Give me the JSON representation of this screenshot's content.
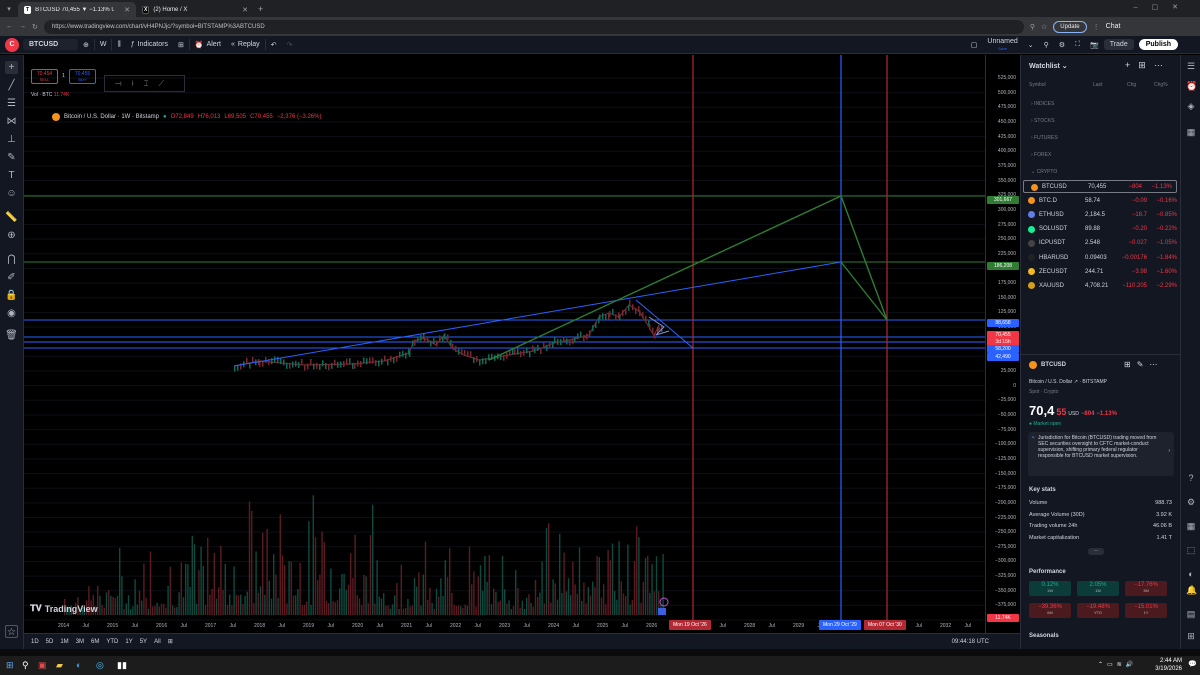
{
  "browser": {
    "tabs": [
      {
        "label": "BTCUSD 70,455 ▼ −1.13% Unna…",
        "fav": "TV"
      },
      {
        "label": "(2) Home / X",
        "fav": "X"
      }
    ],
    "url": "https://www.tradingview.com/chart/vH4PNJjc/?symbol=BITSTAMP%3ABTCUSD",
    "update_label": "Update",
    "chat_label": "Chat"
  },
  "toolbar": {
    "symbol": "BTCUSD",
    "interval": "W",
    "indicators_label": "Indicators",
    "alert_label": "Alert",
    "replay_label": "Replay",
    "layout_name": "Unnamed",
    "layout_sub": "Save",
    "trade_label": "Trade",
    "publish_label": "Publish"
  },
  "legend": {
    "title": "Bitcoin / U.S. Dollar · 1W · Bitstamp",
    "o": "O72,849",
    "h": "H76,013",
    "l": "L69,505",
    "c": "C70,455",
    "chg": "−2,376 (−3.26%)",
    "sell_price": "70,454",
    "sell_label": "SELL",
    "spread": "1",
    "buy_price": "70,455",
    "buy_label": "BUY",
    "vol_label": "Vol · BTC",
    "vol_value": "11.74K"
  },
  "price_axis": {
    "labels": [
      "525,000",
      "500,000",
      "475,000",
      "450,000",
      "425,000",
      "400,000",
      "375,000",
      "350,000",
      "325,000",
      "300,000",
      "275,000",
      "250,000",
      "225,000",
      "200,000",
      "175,000",
      "150,000",
      "125,000",
      "100,000",
      "75,000",
      "50,000",
      "25,000",
      "0",
      "−25,000",
      "−50,000",
      "−75,000",
      "−100,000",
      "−125,000",
      "−150,000",
      "−175,000",
      "−200,000",
      "−225,000",
      "−250,000",
      "−275,000",
      "−300,000",
      "−325,000",
      "−350,000",
      "−375,000",
      "−400,000"
    ],
    "tags": [
      {
        "text": "301,667",
        "color": "#2e7d32"
      },
      {
        "text": "186,208",
        "color": "#2e7d32"
      },
      {
        "text": "88,658",
        "color": "#2962ff"
      },
      {
        "text": "70,455",
        "color": "#f23645"
      },
      {
        "text": "3d 15h",
        "color": "#f23645"
      },
      {
        "text": "58,200",
        "color": "#2962ff"
      },
      {
        "text": "42,490",
        "color": "#2962ff"
      },
      {
        "text": "11.74K",
        "color": "#f23645"
      }
    ]
  },
  "time_axis": {
    "labels": [
      "2014",
      "Jul",
      "2015",
      "Jul",
      "2016",
      "Jul",
      "2017",
      "Jul",
      "2018",
      "Jul",
      "2019",
      "Jul",
      "2020",
      "Jul",
      "2021",
      "Jul",
      "2022",
      "Jul",
      "2023",
      "Jul",
      "2024",
      "Jul",
      "2025",
      "Jul",
      "2026",
      "Jul",
      "2027",
      "Jul",
      "2028",
      "Jul",
      "2029",
      "Jul",
      "2030",
      "Jul",
      "2031",
      "Jul",
      "2032",
      "Jul"
    ],
    "date_tags": [
      {
        "text": "Mon 19 Oct '26",
        "color": "#b22833"
      },
      {
        "text": "Mon 29 Oct '29",
        "color": "#2962ff"
      },
      {
        "text": "Mon 07 Oct '30",
        "color": "#b22833"
      }
    ],
    "clock": "09:44:18 UTC"
  },
  "ranges": [
    "1D",
    "5D",
    "1M",
    "3M",
    "6M",
    "YTD",
    "1Y",
    "5Y",
    "All"
  ],
  "watermark": "TradingView",
  "watchlist": {
    "title": "Watchlist",
    "cols": [
      "Symbol",
      "Last",
      "Chg",
      "Chg%"
    ],
    "groups": [
      "INDICES",
      "STOCKS",
      "FUTURES",
      "FOREX",
      "CRYPTO"
    ],
    "rows": [
      {
        "sym": "BTCUSD",
        "last": "70,455",
        "chg": "−804",
        "pct": "−1.13%",
        "coin": "#f7931a",
        "neg": true
      },
      {
        "sym": "BTC.D",
        "last": "58.74",
        "chg": "−0.09",
        "pct": "−0.16%",
        "coin": "#f7931a",
        "neg": true
      },
      {
        "sym": "ETHUSD",
        "last": "2,184.5",
        "chg": "−18.7",
        "pct": "−0.85%",
        "coin": "#627eea",
        "neg": true
      },
      {
        "sym": "SOLUSDT",
        "last": "89.88",
        "chg": "−0.20",
        "pct": "−0.22%",
        "coin": "#14f195",
        "neg": true
      },
      {
        "sym": "ICPUSDT",
        "last": "2.548",
        "chg": "−0.027",
        "pct": "−1.05%",
        "coin": "#444",
        "neg": true
      },
      {
        "sym": "HBARUSD",
        "last": "0.09403",
        "chg": "−0.00176",
        "pct": "−1.84%",
        "coin": "#222",
        "neg": true
      },
      {
        "sym": "ZECUSDT",
        "last": "244.71",
        "chg": "−3.98",
        "pct": "−1.60%",
        "coin": "#f4b728",
        "neg": true
      },
      {
        "sym": "XAUUSD",
        "last": "4,708.21",
        "chg": "−110.205",
        "pct": "−2.29%",
        "coin": "#d4a017",
        "neg": true
      }
    ]
  },
  "details": {
    "symbol": "BTCUSD",
    "name": "Bitcoin / U.S. Dollar",
    "exchange": "BITSTAMP",
    "type": "Spot · Crypto",
    "price_main": "70,4",
    "price_frac": "55",
    "currency": "USD",
    "chg": "−804",
    "pct": "−1.13%",
    "market": "Market open",
    "news": "Jurisdiction for Bitcoin (BTCUSD) trading moved from SEC securities oversight to CFTC market-conduct supervision, shifting primary federal regulator responsible for BTCUSD market supervision.",
    "keystats_title": "Key stats",
    "stats": [
      {
        "k": "Volume",
        "v": "988.73"
      },
      {
        "k": "Average Volume (30D)",
        "v": "3.92 K"
      },
      {
        "k": "Trading volume 24h",
        "v": "46.06 B"
      },
      {
        "k": "Market capitalization",
        "v": "1.41 T"
      }
    ],
    "perf_title": "Performance",
    "perf": [
      {
        "v": "0.12%",
        "l": "1W",
        "bg": "#0c3c3a",
        "c": "#22ab94"
      },
      {
        "v": "2.05%",
        "l": "1M",
        "bg": "#0c3c3a",
        "c": "#22ab94"
      },
      {
        "v": "−17.76%",
        "l": "3M",
        "bg": "#4a1a1f",
        "c": "#f23645"
      },
      {
        "v": "−39.36%",
        "l": "6M",
        "bg": "#4a1a1f",
        "c": "#f23645"
      },
      {
        "v": "−19.48%",
        "l": "YTD",
        "bg": "#4a1a1f",
        "c": "#f23645"
      },
      {
        "v": "−15.01%",
        "l": "1Y",
        "bg": "#4a1a1f",
        "c": "#f23645"
      }
    ],
    "seasonals": "Seasonals"
  },
  "taskbar": {
    "time": "2:44 AM",
    "date": "3/19/2026"
  }
}
